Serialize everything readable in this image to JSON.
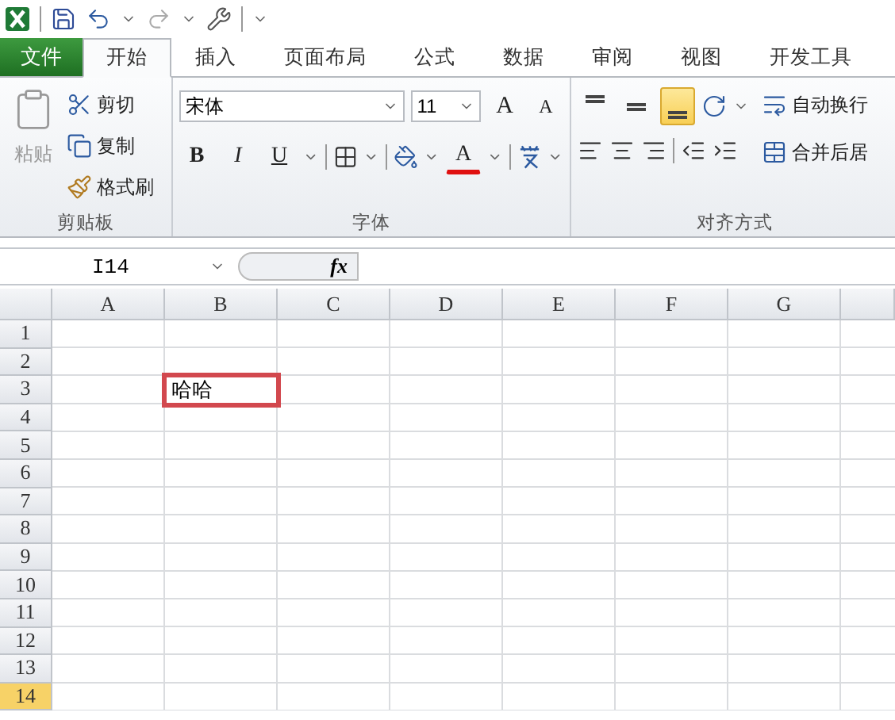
{
  "tabs": [
    {
      "label": "文件",
      "kind": "file",
      "selected": false
    },
    {
      "label": "开始",
      "kind": "tab",
      "selected": true
    },
    {
      "label": "插入",
      "kind": "tab",
      "selected": false
    },
    {
      "label": "页面布局",
      "kind": "tab",
      "selected": false
    },
    {
      "label": "公式",
      "kind": "tab",
      "selected": false
    },
    {
      "label": "数据",
      "kind": "tab",
      "selected": false
    },
    {
      "label": "审阅",
      "kind": "tab",
      "selected": false
    },
    {
      "label": "视图",
      "kind": "tab",
      "selected": false
    },
    {
      "label": "开发工具",
      "kind": "tab",
      "selected": false
    }
  ],
  "ribbon": {
    "clipboard": {
      "title": "剪贴板",
      "paste": {
        "label": "粘贴",
        "disabled": true
      },
      "items": [
        {
          "label": "剪切",
          "kind": "cut"
        },
        {
          "label": "复制",
          "kind": "copy"
        },
        {
          "label": "格式刷",
          "kind": "painter"
        }
      ]
    },
    "font": {
      "title": "字体",
      "font_name": "宋体",
      "font_size": "11",
      "grow": "A",
      "shrink": "A",
      "format_buttons": [
        {
          "label": "B",
          "kind": "bold"
        },
        {
          "label": "I",
          "kind": "italic"
        },
        {
          "label": "U",
          "kind": "underline"
        }
      ],
      "font_color": "A"
    },
    "alignment": {
      "title": "对齐方式",
      "vertical_align": [
        {
          "kind": "top",
          "selected": false
        },
        {
          "kind": "middle",
          "selected": false
        },
        {
          "kind": "bottom",
          "selected": true
        }
      ],
      "wrap_text": "自动换行",
      "merge": "合并后居"
    }
  },
  "formula_bar": {
    "name_box": "I14",
    "function_label": "fx"
  },
  "sheet": {
    "columns": [
      {
        "label": "A"
      },
      {
        "label": "B"
      },
      {
        "label": "C"
      },
      {
        "label": "D"
      },
      {
        "label": "E"
      },
      {
        "label": "F"
      },
      {
        "label": "G"
      }
    ],
    "rows": [
      {
        "label": "1",
        "selected": false
      },
      {
        "label": "2",
        "selected": false
      },
      {
        "label": "3",
        "selected": false,
        "cells": [
          null,
          {
            "text": "哈哈",
            "highlighted": true
          }
        ]
      },
      {
        "label": "4",
        "selected": false
      },
      {
        "label": "5",
        "selected": false
      },
      {
        "label": "6",
        "selected": false
      },
      {
        "label": "7",
        "selected": false
      },
      {
        "label": "8",
        "selected": false
      },
      {
        "label": "9",
        "selected": false
      },
      {
        "label": "10",
        "selected": false
      },
      {
        "label": "11",
        "selected": false
      },
      {
        "label": "12",
        "selected": false
      },
      {
        "label": "13",
        "selected": false
      },
      {
        "label": "14",
        "selected": true
      }
    ]
  }
}
